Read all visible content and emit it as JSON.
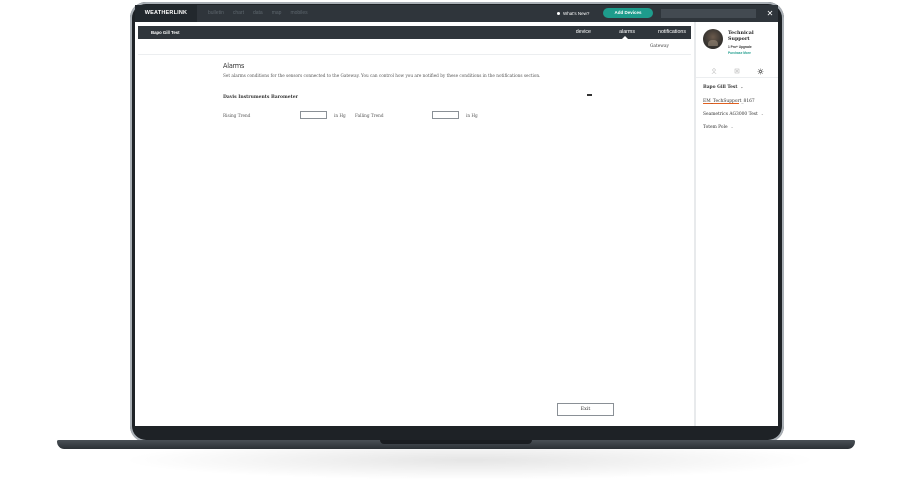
{
  "topbar": {
    "logo": "WEATHERLINK",
    "nav": [
      "bulletin",
      "chart",
      "data",
      "map",
      "mobiles"
    ],
    "whats_new": "What's New?",
    "add_devices": "Add Devices",
    "close_icon": "close-icon"
  },
  "subbar": {
    "device_name": "Bapo Gill Test",
    "tabs": {
      "device": "device",
      "alarms": "alarms",
      "notifications": "notifications"
    },
    "gateway": "Gateway"
  },
  "content": {
    "title": "Alarms",
    "description": "Set alarms conditions for the sensors connected to the Gateway. You can control how you are notified by these conditions in the notifications section.",
    "sensor_title": "Davis Instruments Barometer",
    "rising_label": "Rising Trend",
    "rising_value": "",
    "rising_unit": "in Hg",
    "falling_label": "Falling Trend",
    "falling_value": "",
    "falling_unit": "in Hg",
    "exit": "Exit"
  },
  "sidebar": {
    "profile_name": "Technical Support",
    "upgrade": "1 Pro+ Upgrade",
    "purchase_more": "Purchase More",
    "tab_icons": [
      "user-icon",
      "station-icon",
      "gear-icon"
    ],
    "devices": [
      {
        "label": "Bapo Gill Test",
        "active": true
      },
      {
        "label": "EM_TechSupport_8167",
        "active": false
      },
      {
        "label": "Seametrics AG3000 Test",
        "active": false
      },
      {
        "label": "Totem Pole",
        "active": false
      }
    ]
  },
  "colors": {
    "topbar": "#2f353b",
    "accent": "#1e9c8c",
    "active_underline": "#e06020"
  }
}
